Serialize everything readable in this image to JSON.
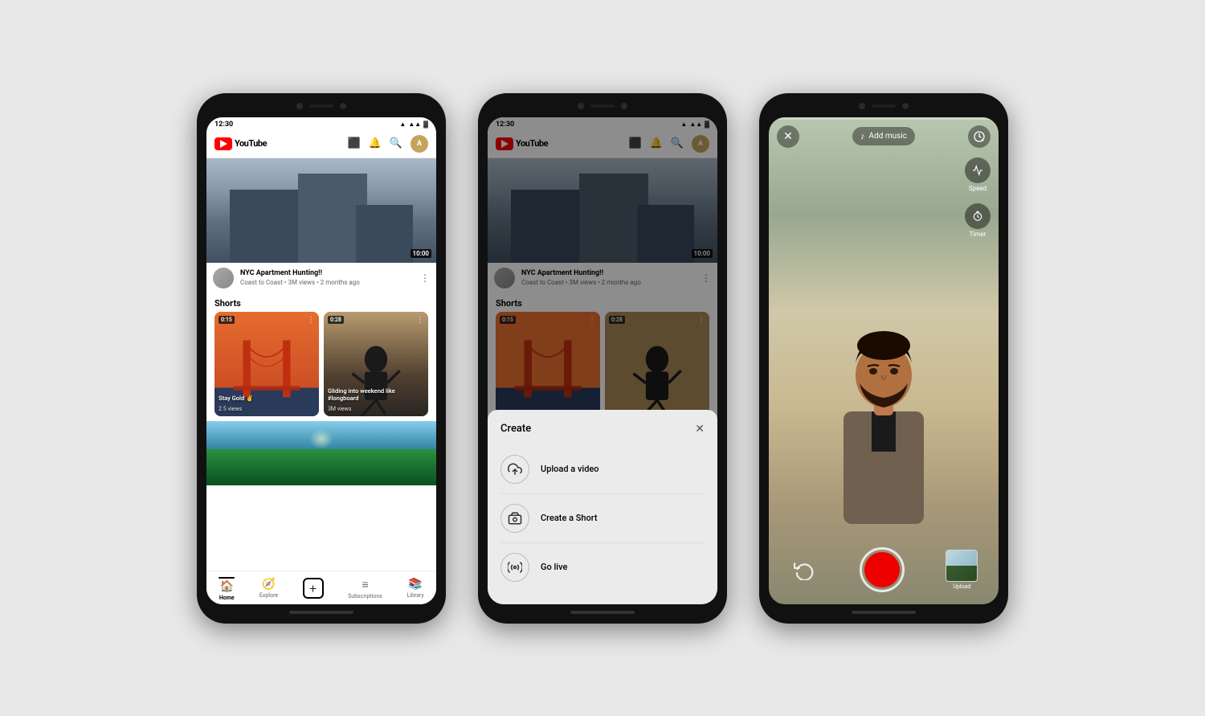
{
  "phones": {
    "phone1": {
      "status": {
        "time": "12:30",
        "signal": "▲▲▲",
        "wifi": "WiFi",
        "battery": "▓"
      },
      "header": {
        "logo_text": "YouTube",
        "icons": [
          "cast",
          "bell",
          "search",
          "avatar"
        ]
      },
      "main_video": {
        "duration": "10:00",
        "title": "NYC Apartment Hunting!!",
        "meta": "Coast to Coast • 3M views • 2 months ago"
      },
      "shorts_label": "Shorts",
      "shorts": [
        {
          "duration": "0:15",
          "title": "Stay Gold ✌",
          "views": "2.5 views",
          "type": "golden-gate"
        },
        {
          "duration": "0:28",
          "title": "Gliding into weekend like #longboard",
          "views": "3M views",
          "type": "skater"
        }
      ],
      "bottom_nav": [
        {
          "label": "Home",
          "icon": "🏠",
          "active": true
        },
        {
          "label": "Explore",
          "icon": "🧭",
          "active": false
        },
        {
          "label": "",
          "icon": "+",
          "active": false,
          "is_plus": true
        },
        {
          "label": "Subscriptions",
          "icon": "≡",
          "active": false
        },
        {
          "label": "Library",
          "icon": "📚",
          "active": false
        }
      ]
    },
    "phone2": {
      "status": {
        "time": "12:30"
      },
      "header": {
        "logo_text": "YouTube"
      },
      "main_video": {
        "duration": "10:00",
        "title": "NYC Apartment Hunting!!",
        "meta": "Coast to Coast • 3M views • 2 months ago"
      },
      "shorts_label": "Shorts",
      "shorts": [
        {
          "duration": "0:15",
          "type": "golden-gate"
        },
        {
          "duration": "0:28",
          "type": "skater"
        }
      ],
      "create_modal": {
        "title": "Create",
        "close_label": "✕",
        "items": [
          {
            "icon": "⬆",
            "label": "Upload a video"
          },
          {
            "icon": "📷",
            "label": "Create a Short"
          },
          {
            "icon": "((•))",
            "label": "Go live"
          }
        ]
      }
    },
    "phone3": {
      "camera": {
        "close_icon": "✕",
        "music_button": "Add music",
        "music_icon": "♪",
        "speed_icon": "⏱",
        "right_controls": [
          {
            "icon": "⏱",
            "label": "Speed"
          },
          {
            "icon": "⏱",
            "label": "Timer"
          }
        ],
        "flip_icon": "↺",
        "upload_label": "Upload"
      }
    }
  }
}
